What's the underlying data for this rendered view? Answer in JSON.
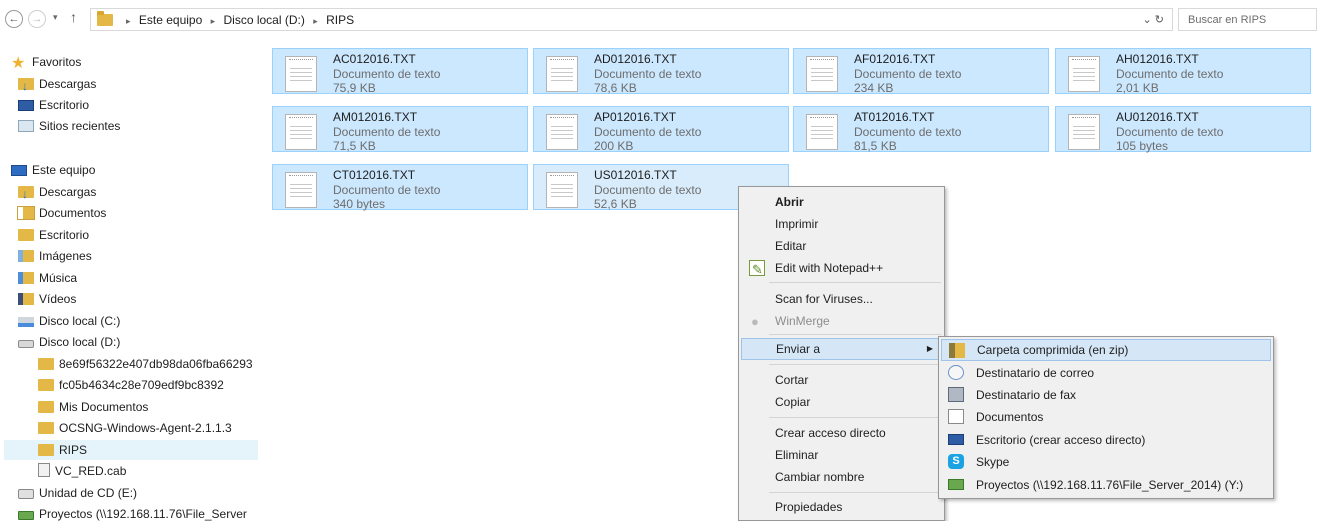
{
  "address": {
    "back_glyph": "←",
    "forward_glyph": "→",
    "dropdown_glyph": "▾",
    "up_glyph": "↑",
    "crumbs": [
      "Este equipo",
      "Disco local (D:)",
      "RIPS"
    ],
    "crumb_sep": "▸",
    "tools_glyph": "⌄  ↻",
    "search_placeholder": "Buscar en RIPS"
  },
  "nav": {
    "favorites": "Favoritos",
    "fav_items": [
      "Descargas",
      "Escritorio",
      "Sitios recientes"
    ],
    "this_pc": "Este equipo",
    "pc_items": [
      "Descargas",
      "Documentos",
      "Escritorio",
      "Imágenes",
      "Música",
      "Vídeos",
      "Disco local (C:)",
      "Disco local (D:)"
    ],
    "d_items": [
      "8e69f56322e407db98da06fba66293",
      "fc05b4634c28e709edf9bc8392",
      "Mis Documentos",
      "OCSNG-Windows-Agent-2.1.1.3",
      "RIPS",
      "VC_RED.cab"
    ],
    "extra_items": [
      "Unidad de CD (E:)",
      "Proyectos (\\\\192.168.11.76\\File_Server"
    ]
  },
  "files": [
    {
      "name": "AC012016.TXT",
      "type": "Documento de texto",
      "size": "75,9 KB"
    },
    {
      "name": "AD012016.TXT",
      "type": "Documento de texto",
      "size": "78,6 KB"
    },
    {
      "name": "AF012016.TXT",
      "type": "Documento de texto",
      "size": "234 KB"
    },
    {
      "name": "AH012016.TXT",
      "type": "Documento de texto",
      "size": "2,01 KB"
    },
    {
      "name": "AM012016.TXT",
      "type": "Documento de texto",
      "size": "71,5 KB"
    },
    {
      "name": "AP012016.TXT",
      "type": "Documento de texto",
      "size": "200 KB"
    },
    {
      "name": "AT012016.TXT",
      "type": "Documento de texto",
      "size": "81,5 KB"
    },
    {
      "name": "AU012016.TXT",
      "type": "Documento de texto",
      "size": "105 bytes"
    },
    {
      "name": "CT012016.TXT",
      "type": "Documento de texto",
      "size": "340 bytes"
    },
    {
      "name": "US012016.TXT",
      "type": "Documento de texto",
      "size": "52,6 KB"
    }
  ],
  "context_menu": {
    "open": "Abrir",
    "print": "Imprimir",
    "edit": "Editar",
    "edit_npp": "Edit with Notepad++",
    "scan": "Scan for Viruses...",
    "winmerge": "WinMerge",
    "send_to": "Enviar a",
    "send_to_arrow": "▶",
    "cut": "Cortar",
    "copy": "Copiar",
    "shortcut": "Crear acceso directo",
    "delete": "Eliminar",
    "rename": "Cambiar nombre",
    "properties": "Propiedades"
  },
  "send_to_menu": {
    "zip": "Carpeta comprimida (en zip)",
    "mail": "Destinatario de correo",
    "fax": "Destinatario de fax",
    "docs": "Documentos",
    "desktop": "Escritorio (crear acceso directo)",
    "skype": "Skype",
    "skype_glyph": "S",
    "network": "Proyectos (\\\\192.168.11.76\\File_Server_2014) (Y:)"
  }
}
